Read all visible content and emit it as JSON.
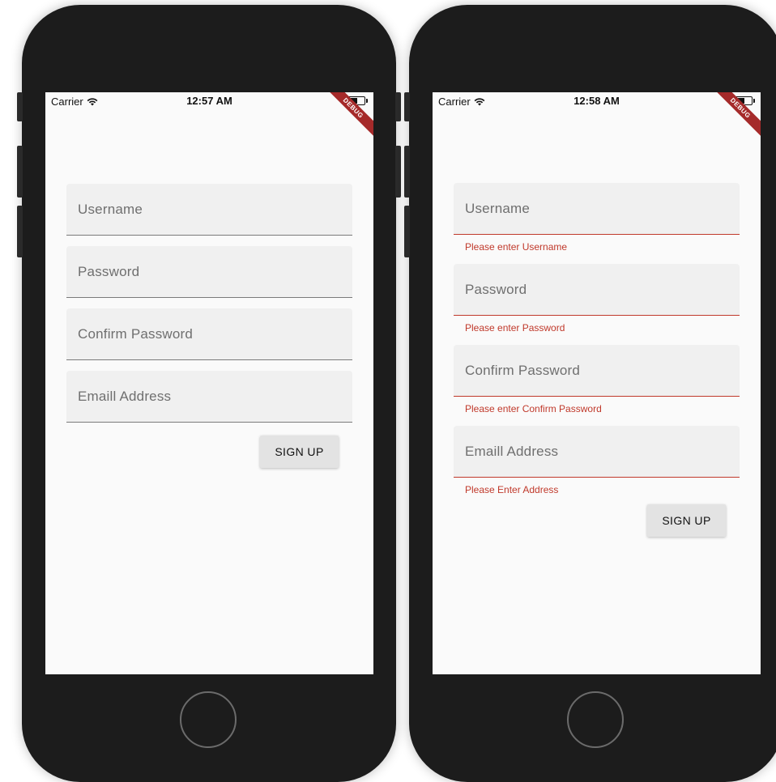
{
  "left_phone": {
    "status": {
      "carrier": "Carrier",
      "time": "12:57 AM",
      "debug": "DEBUG"
    },
    "fields": [
      {
        "label": "Username"
      },
      {
        "label": "Password"
      },
      {
        "label": "Confirm Password"
      },
      {
        "label": "Emaill Address"
      }
    ],
    "signup_label": "SIGN UP"
  },
  "right_phone": {
    "status": {
      "carrier": "Carrier",
      "time": "12:58 AM",
      "debug": "DEBUG"
    },
    "fields": [
      {
        "label": "Username",
        "error": "Please enter Username"
      },
      {
        "label": "Password",
        "error": "Please enter Password"
      },
      {
        "label": "Confirm Password",
        "error": "Please enter Confirm Password"
      },
      {
        "label": "Emaill Address",
        "error": "Please Enter Address"
      }
    ],
    "signup_label": "SIGN UP"
  },
  "colors": {
    "phone_body": "#1c1c1c",
    "screen_bg": "#fafafa",
    "field_bg": "#f0f0f0",
    "error": "#c0392b",
    "debug_banner": "#a52a2a"
  },
  "icons": [
    "wifi-icon",
    "battery-icon",
    "home-button"
  ]
}
